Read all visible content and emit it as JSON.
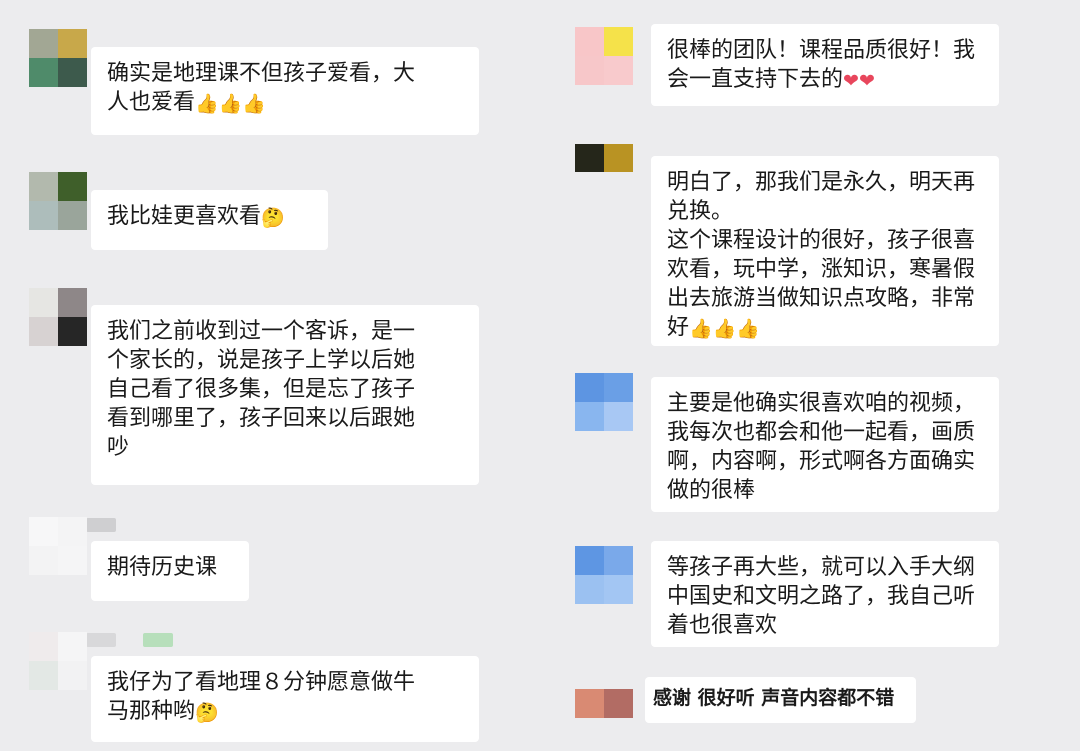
{
  "left_column": [
    {
      "id": "l1",
      "lines": [
        "确实是地理课不但孩子爱看，大",
        "人也爱看"
      ],
      "trailing_emoji": [
        "thumbs-up",
        "thumbs-up",
        "thumbs-up"
      ],
      "avatar_colors": [
        "#a2a794",
        "#c8a84a",
        "#4f8b6a",
        "#3d5a4c"
      ]
    },
    {
      "id": "l2",
      "lines": [
        "我比娃更喜欢看"
      ],
      "trailing_emoji": [
        "thinking-face"
      ],
      "avatar_colors": [
        "#b2b9ad",
        "#3f5f2a",
        "#adbdbb",
        "#9aa59b"
      ]
    },
    {
      "id": "l3",
      "lines": [
        "我们之前收到过一个客诉，是一",
        "个家长的，说是孩子上学以后她",
        "自己看了很多集，但是忘了孩子",
        "看到哪里了，孩子回来以后跟她",
        "吵"
      ],
      "trailing_emoji": [],
      "avatar_colors": [
        "#e6e6e3",
        "#8e8788",
        "#d7d2d2",
        "#262626"
      ]
    },
    {
      "id": "l4",
      "lines": [
        "期待历史课"
      ],
      "trailing_emoji": [],
      "avatar_colors": [
        "#f7f7f8",
        "#f4f4f5",
        "#f3f3f4",
        "#f5f5f6"
      ]
    },
    {
      "id": "l5",
      "lines": [
        "我仔为了看地理８分钟愿意做牛",
        "马那种哟"
      ],
      "trailing_emoji": [
        "thinking-face"
      ],
      "avatar_colors": [
        "#efebec",
        "#f5f5f6",
        "#e3e8e5",
        "#f2f2f3"
      ]
    }
  ],
  "right_column": [
    {
      "id": "r1",
      "lines": [
        "很棒的团队！课程品质很好！我",
        "会一直支持下去的"
      ],
      "trailing_emoji": [
        "red-heart",
        "red-heart"
      ],
      "avatar_colors": [
        "#f8c6c8",
        "#f5e24a",
        "#f7c7c9",
        "#f8cacc"
      ]
    },
    {
      "id": "r2",
      "lines": [
        "明白了，那我们是永久，明天再",
        "兑换。",
        "这个课程设计的很好，孩子很喜",
        "欢看，玩中学，涨知识，寒暑假",
        "出去旅游当做知识点攻略，非常",
        "好"
      ],
      "trailing_emoji": [
        "thumbs-up",
        "thumbs-up",
        "thumbs-up"
      ],
      "avatar_colors": [
        "#25261a",
        "#b99323",
        "#ededee",
        "#ededee"
      ]
    },
    {
      "id": "r3",
      "lines": [
        "主要是他确实很喜欢咱的视频，",
        "我每次也都会和他一起看，画质",
        "啊，内容啊，形式啊各方面确实",
        "做的很棒"
      ],
      "trailing_emoji": [],
      "avatar_colors": [
        "#5d95e2",
        "#6a9fe6",
        "#89b6ef",
        "#a8c8f4"
      ]
    },
    {
      "id": "r4",
      "lines": [
        "等孩子再大些，就可以入手大纲",
        "中国史和文明之路了，我自己听",
        "着也很喜欢"
      ],
      "trailing_emoji": [],
      "avatar_colors": [
        "#5e96e3",
        "#7aa9ea",
        "#9bc1f1",
        "#a3c6f3"
      ]
    },
    {
      "id": "r5",
      "lines": [
        "感谢 很好听 声音内容都不错"
      ],
      "trailing_emoji": [],
      "avatar_colors": [
        "#d98a73",
        "#b26c64",
        "#ededee",
        "#ededee"
      ]
    }
  ]
}
